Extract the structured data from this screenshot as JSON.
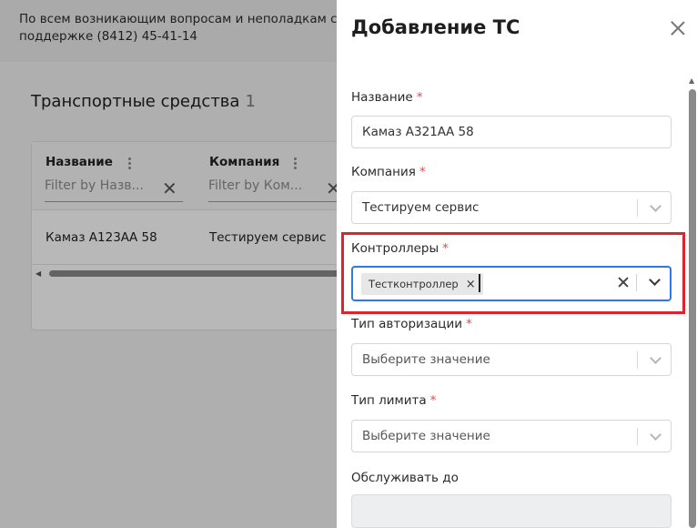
{
  "background": {
    "notice_line1": "По всем возникающим вопросам и неполадкам соо",
    "notice_line2": "поддержке (8412) 45-41-14",
    "page_title": "Транспортные средства",
    "page_count": "1",
    "table": {
      "columns": [
        {
          "label": "Название",
          "filter_placeholder": "Filter by Назв..."
        },
        {
          "label": "Компания",
          "filter_placeholder": "Filter by Ком..."
        }
      ],
      "rows": [
        {
          "name": "Камаз А123АА 58",
          "company": "Тестируем сервис"
        }
      ]
    }
  },
  "drawer": {
    "title": "Добавление ТС",
    "fields": {
      "name": {
        "label": "Название",
        "value": "Камаз А321АА 58",
        "required": "*"
      },
      "company": {
        "label": "Компания",
        "value": "Тестируем сервис",
        "required": "*"
      },
      "controllers": {
        "label": "Контроллеры",
        "chips": [
          "Тестконтроллер"
        ],
        "chip_remove": "×",
        "required": "*"
      },
      "auth_type": {
        "label": "Тип авторизации",
        "placeholder": "Выберите значение",
        "required": "*"
      },
      "limit_type": {
        "label": "Тип лимита",
        "placeholder": "Выберите значение",
        "required": "*"
      },
      "serve_until": {
        "label": "Обслуживать до",
        "value": ""
      }
    }
  },
  "colors": {
    "highlight": "#e0222d",
    "focus": "#2c7be5",
    "required": "#e5484d"
  },
  "icons": [
    "close-icon",
    "chevron-down-icon",
    "clear-icon",
    "kebab-menu-icon"
  ]
}
